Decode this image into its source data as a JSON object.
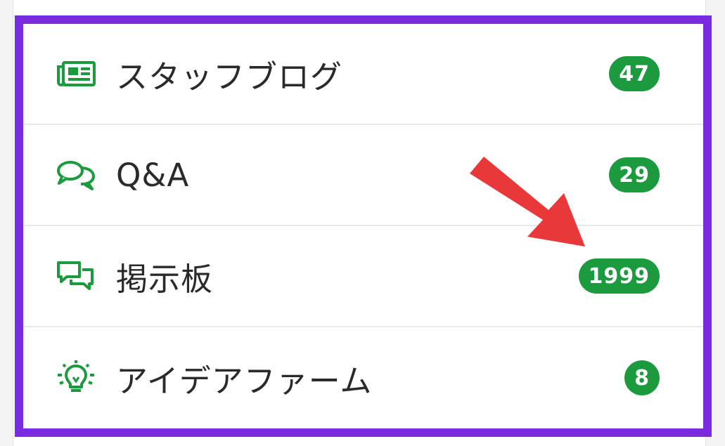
{
  "menu": {
    "items": [
      {
        "label": "スタッフブログ",
        "count": "47",
        "icon": "newspaper-icon"
      },
      {
        "label": "Q&A",
        "count": "29",
        "icon": "chat-bubbles-icon"
      },
      {
        "label": "掲示板",
        "count": "1999",
        "icon": "message-board-icon"
      },
      {
        "label": "アイデアファーム",
        "count": "8",
        "icon": "lightbulb-icon"
      }
    ]
  },
  "colors": {
    "accent_green": "#1c9a3e",
    "highlight_purple": "#7a2be0",
    "arrow_red": "#e8383a"
  }
}
